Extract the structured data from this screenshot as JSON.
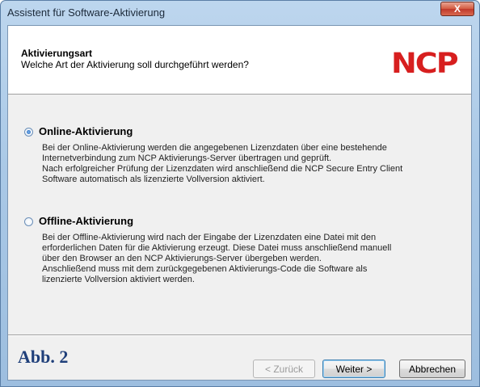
{
  "window": {
    "title": "Assistent für Software-Aktivierung",
    "close_glyph": "X"
  },
  "header": {
    "title": "Aktivierungsart",
    "subtitle": "Welche Art der Aktivierung soll durchgeführt werden?",
    "logo_text": "NCP",
    "logo_color": "#d71f1f"
  },
  "options": [
    {
      "label": "Online-Aktivierung",
      "selected": true,
      "lines": [
        "Bei der Online-Aktivierung werden die angegebenen Lizenzdaten über eine bestehende",
        "Internetverbindung zum NCP Aktivierungs-Server übertragen und geprüft.",
        "Nach erfolgreicher Prüfung der Lizenzdaten wird anschließend die NCP Secure Entry Client",
        "Software automatisch als lizenzierte Vollversion aktiviert."
      ]
    },
    {
      "label": "Offline-Aktivierung",
      "selected": false,
      "lines": [
        "Bei der Offline-Aktivierung wird nach der Eingabe der Lizenzdaten eine Datei mit den",
        "erforderlichen Daten für die Aktivierung erzeugt. Diese Datei muss anschließend manuell",
        "über den Browser an den NCP Aktivierungs-Server übergeben werden.",
        "Anschließend muss mit dem zurückgegebenen Aktivierungs-Code die Software als",
        "lizenzierte Vollversion aktiviert werden."
      ]
    }
  ],
  "footer": {
    "caption": "Abb. 2",
    "back_label": "< Zurück",
    "next_label": "Weiter >",
    "cancel_label": "Abbrechen"
  }
}
